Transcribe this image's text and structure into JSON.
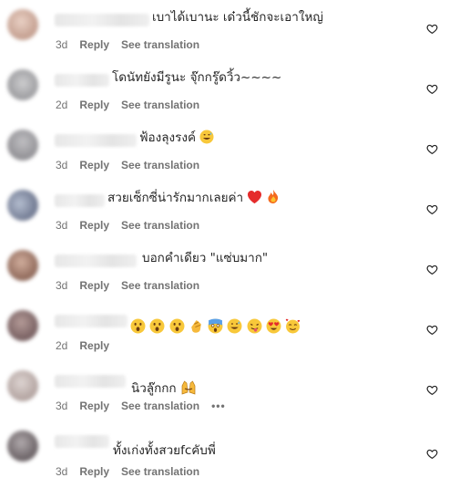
{
  "comments": [
    {
      "text": "เบาได้เบานะ เด๋วนี้ชักจะเอาใหญ่",
      "time": "3d",
      "reply": "Reply",
      "translate": "See translation",
      "avatar_color": "#caa89a",
      "emojis": []
    },
    {
      "text": "โดนัทยังมีรูนะ จุ๊กกรู๊ดวิ้ว~~~~",
      "time": "2d",
      "reply": "Reply",
      "translate": "See translation",
      "avatar_color": "#9a9a9c",
      "emojis": []
    },
    {
      "text": "ฟ้องลุงรงค์",
      "time": "3d",
      "reply": "Reply",
      "translate": "See translation",
      "avatar_color": "#8f8e92",
      "emojis": [
        "grin-sweat"
      ]
    },
    {
      "text": "สวยเซ็กซี่น่ารักมากเลยค่า",
      "time": "3d",
      "reply": "Reply",
      "translate": "See translation",
      "avatar_color": "#7c8aa5",
      "emojis": [
        "red-heart",
        "fire"
      ]
    },
    {
      "text": "บอกคำเดียว \"แซ่บมาก\"",
      "time": "3d",
      "reply": "Reply",
      "translate": "See translation",
      "avatar_color": "#9a7160",
      "emojis": []
    },
    {
      "text": "",
      "time": "2d",
      "reply": "Reply",
      "translate": "",
      "avatar_color": "#7b6060",
      "emojis": [
        "astonished",
        "astonished",
        "astonished",
        "clap",
        "scream",
        "grin-sweat",
        "tongue-out",
        "heart-eyes",
        "smiling-hearts"
      ]
    },
    {
      "text": "นิวลู๊กกก",
      "time": "3d",
      "reply": "Reply",
      "translate": "See translation",
      "more": "•••",
      "avatar_color": "#b9aba7",
      "emojis": [
        "raised-hands"
      ]
    },
    {
      "text": "ทั้งเก่งทั้งสวยfcคับพี่",
      "time": "3d",
      "reply": "Reply",
      "translate": "See translation",
      "avatar_color": "#6f6468",
      "emojis": []
    }
  ]
}
